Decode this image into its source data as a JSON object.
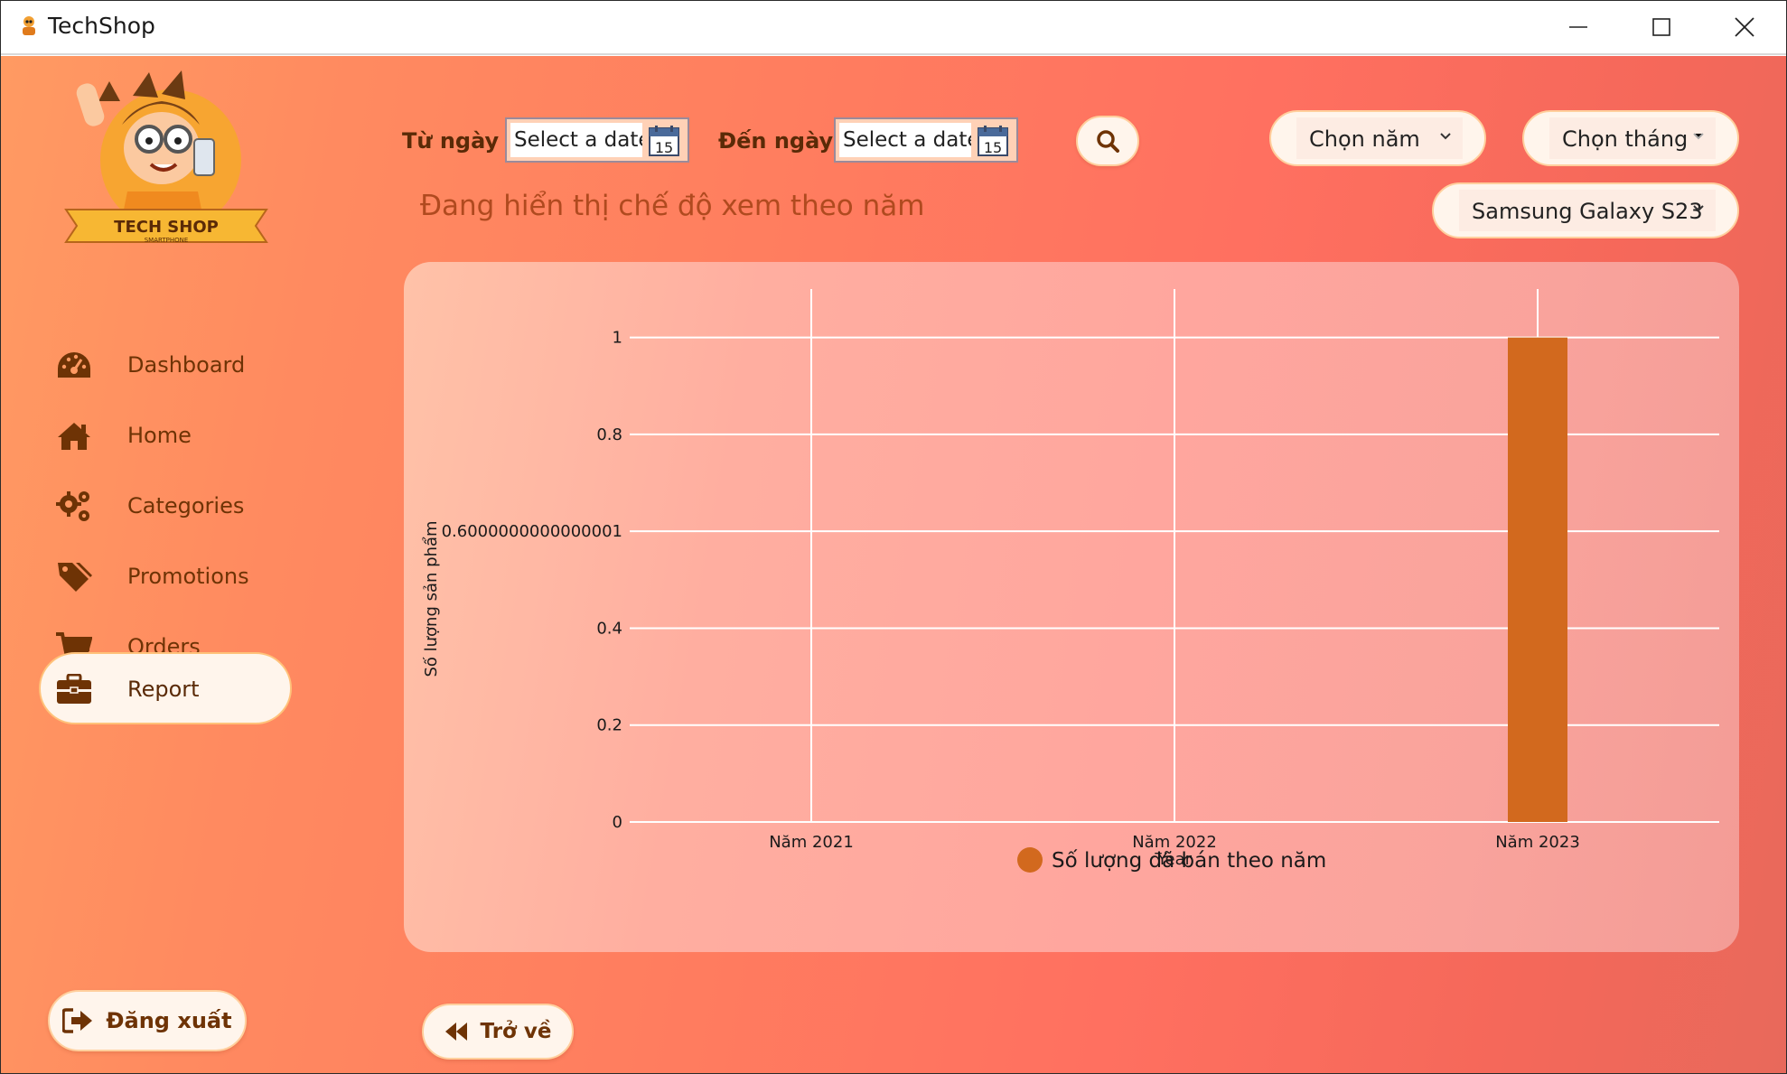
{
  "window": {
    "title": "TechShop"
  },
  "sidebar": {
    "logo_text": "TECH SHOP",
    "logo_subtext": "SMARTPHONE",
    "items": [
      {
        "label": "Dashboard",
        "icon": "dashboard-icon",
        "active": false
      },
      {
        "label": "Home",
        "icon": "home-icon",
        "active": false
      },
      {
        "label": "Categories",
        "icon": "cogs-icon",
        "active": false
      },
      {
        "label": "Promotions",
        "icon": "tags-icon",
        "active": false
      },
      {
        "label": "Orders",
        "icon": "cart-icon",
        "active": false
      },
      {
        "label": "Report",
        "icon": "briefcase-icon",
        "active": true
      }
    ],
    "logout_label": "Đăng xuất"
  },
  "filters": {
    "from_label": "Từ ngày",
    "to_label": "Đến ngày",
    "from_placeholder": "Select a date",
    "to_placeholder": "Select a date",
    "calendar_day": "15",
    "year_select": "Chọn năm",
    "month_select": "Chọn tháng",
    "product_select": "Samsung Galaxy S23"
  },
  "mode_text": "Đang hiển thị chế độ xem theo năm",
  "back_label": "Trở về",
  "colors": {
    "accent_brown": "#6e3305",
    "bar": "#d2691e",
    "panel_border": "#ffcf9d"
  },
  "chart_data": {
    "type": "bar",
    "categories": [
      "Năm 2021",
      "Năm 2022",
      "Năm 2023"
    ],
    "series": [
      {
        "name": "Số lượng đã bán theo năm",
        "values": [
          0,
          0,
          1
        ]
      }
    ],
    "xlabel": "Year",
    "ylabel": "Số lượng sản phẩm",
    "yticks": [
      "0",
      "0.2",
      "0.4",
      "0.6000000000000001",
      "0.8",
      "1"
    ],
    "ylim": [
      0,
      1.1
    ],
    "grid": true,
    "legend_position": "bottom-center"
  }
}
